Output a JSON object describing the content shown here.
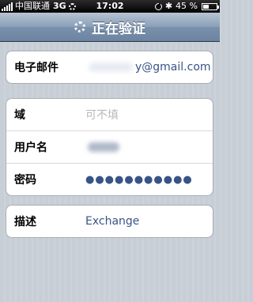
{
  "statusbar": {
    "carrier": "中国联通",
    "network": "3G",
    "time": "17:02",
    "battery_pct": "45 %",
    "battery_level": 0.45
  },
  "navbar": {
    "title": "正在验证"
  },
  "email_group": {
    "label": "电子邮件",
    "value": "y@gmail.com"
  },
  "account_group": {
    "domain_label": "域",
    "domain_placeholder": "可不填",
    "username_label": "用户名",
    "password_label": "密码",
    "password_mask": "●●●●●●●●●●●"
  },
  "description_group": {
    "label": "描述",
    "value": "Exchange"
  }
}
